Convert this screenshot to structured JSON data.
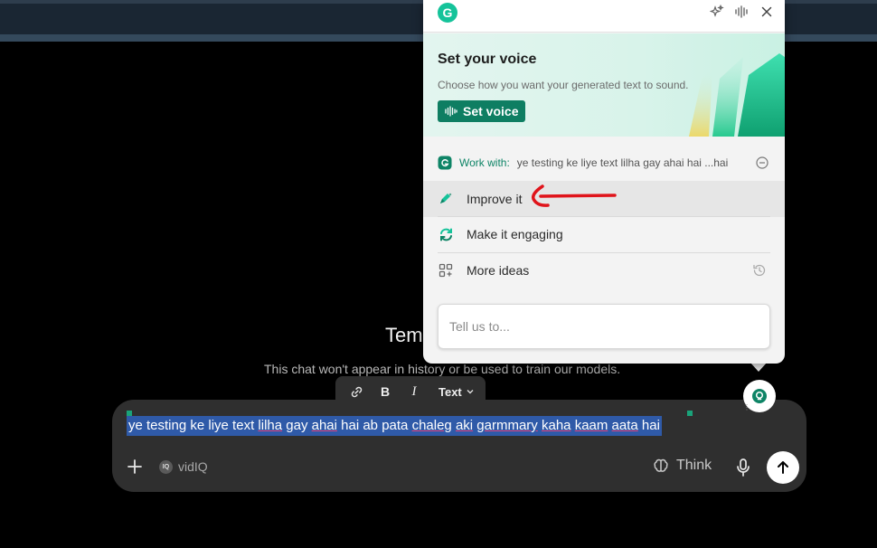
{
  "chat": {
    "title": "Tem",
    "subtitle": "This chat won't appear in history or be used to train our models."
  },
  "format_toolbar": {
    "bold": "B",
    "italic": "I",
    "text_style": "Text"
  },
  "composer": {
    "selected_text_parts": [
      "ye testing ke liye text ",
      "lilha",
      " gay ",
      "ahai",
      "  hai ab pata ",
      "chaleg",
      " ",
      "aki",
      " ",
      "garmmary",
      " ",
      "kaha",
      " ",
      "kaam",
      " ",
      "aata",
      " hai"
    ],
    "vidiq_label": "vidIQ",
    "vidiq_logo": "IQ",
    "think_label": "Think"
  },
  "grammarly": {
    "logo_letter": "G",
    "voice_card": {
      "title": "Set your voice",
      "description": "Choose how you want your generated text to sound.",
      "button_label": "Set voice"
    },
    "work_with": {
      "label": "Work with:",
      "text": "ye testing ke liye text lilha gay ahai hai ...hai"
    },
    "menu": [
      {
        "label": "Improve it",
        "icon": "pencil-sparkle-icon"
      },
      {
        "label": "Make it engaging",
        "icon": "refresh-icon"
      },
      {
        "label": "More ideas",
        "icon": "grid-plus-icon"
      }
    ],
    "input_placeholder": "Tell us to..."
  },
  "colors": {
    "grammarly_green": "#15c39a",
    "set_voice_button": "#0e7e62",
    "selection": "#2f5aa8",
    "annotation_arrow": "#e0141b"
  }
}
